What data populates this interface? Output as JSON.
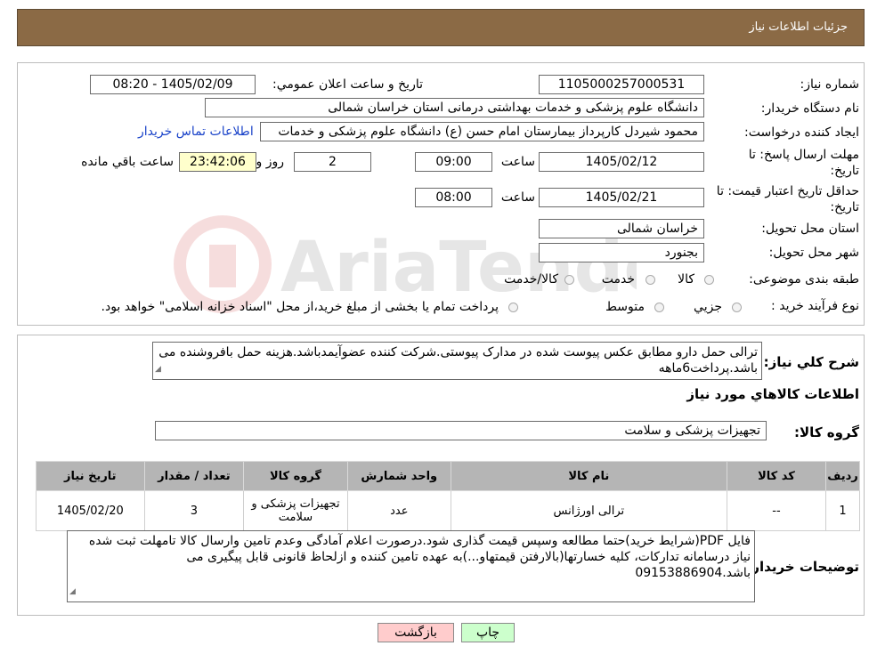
{
  "header": {
    "title": "جزئیات اطلاعات نیاز"
  },
  "form": {
    "need_number_label": "شماره نیاز:",
    "need_number": "1105000257000531",
    "announce_label": "تاریخ و ساعت اعلان عمومي:",
    "announce_value": "1405/02/09 - 08:20",
    "buyer_org_label": "نام دستگاه خريدار:",
    "buyer_org": "دانشگاه علوم پزشکی و خدمات بهداشتی درمانی استان خراسان شمالی",
    "creator_label": "ايجاد کننده درخواست:",
    "creator": "محمود شیردل کارپرداز بیمارستان امام حسن (ع) دانشگاه علوم پزشکی و خدمات",
    "contact_link": "اطلاعات تماس خريدار",
    "deadline_label": "مهلت ارسال پاسخ: تا تاریخ:",
    "deadline_date": "1405/02/12",
    "time_label": "ساعت",
    "deadline_time": "09:00",
    "days_value": "2",
    "days_label": "روز و",
    "remaining_time": "23:42:06",
    "remaining_label": "ساعت باقي مانده",
    "validity_label": "حداقل تاریخ اعتبار قیمت: تا تاریخ:",
    "validity_date": "1405/02/21",
    "validity_time": "08:00",
    "province_label": "استان محل تحویل:",
    "province": "خراسان شمالی",
    "city_label": "شهر محل تحویل:",
    "city": "بجنورد",
    "category_label": "طبقه بندی موضوعی:",
    "category_options": [
      "کالا",
      "خدمت",
      "کالا/خدمت"
    ],
    "process_label": "نوع فرآیند خرید :",
    "process_options": [
      "جزيي",
      "متوسط"
    ],
    "process_note": "پرداخت تمام یا بخشی از مبلغ خرید،از محل \"اسناد خزانه اسلامی\" خواهد بود."
  },
  "description": {
    "label": "شرح کلي نياز:",
    "text": "ترالی حمل دارو مطابق عکس پیوست شده در مدارک پیوستی.شرکت کننده عضوآیمدباشد.هزینه حمل بافروشنده می باشد.پرداخت6ماهه"
  },
  "goods": {
    "section_title": "اطلاعات کالاهاي مورد نياز",
    "group_label": "گروه کالا:",
    "group_value": "تجهیزات پزشکی و سلامت",
    "columns": [
      "رديف",
      "کد کالا",
      "نام کالا",
      "واحد شمارش",
      "گروه کالا",
      "تعداد / مقدار",
      "تاريخ نياز"
    ],
    "rows": [
      {
        "index": "1",
        "code": "--",
        "name": "ترالی اورژانس",
        "unit": "عدد",
        "group": "تجهیزات پزشکی و سلامت",
        "qty": "3",
        "date": "1405/02/20"
      }
    ]
  },
  "buyer_notes": {
    "label": "توضیحات خریدار:",
    "text": "فایل PDF(شرایط خرید)حتما مطالعه وسپس قیمت گذاری شود.درصورت اعلام آمادگی وعدم تامین وارسال کالا تامهلت ثبت شده نیاز درسامانه تدارکات، کلیه خسارتها(بالارفتن قیمتهاو...)به عهده تامین کننده و ازلحاظ قانونی قابل پیگیری می باشد.09153886904"
  },
  "buttons": {
    "print": "چاپ",
    "back": "بازگشت"
  },
  "colors": {
    "header_bg": "#8b6a45",
    "link": "#1a43c9",
    "print_btn": "#ccffcc",
    "back_btn": "#ffcccc",
    "remaining_bg": "#ffffcc"
  }
}
